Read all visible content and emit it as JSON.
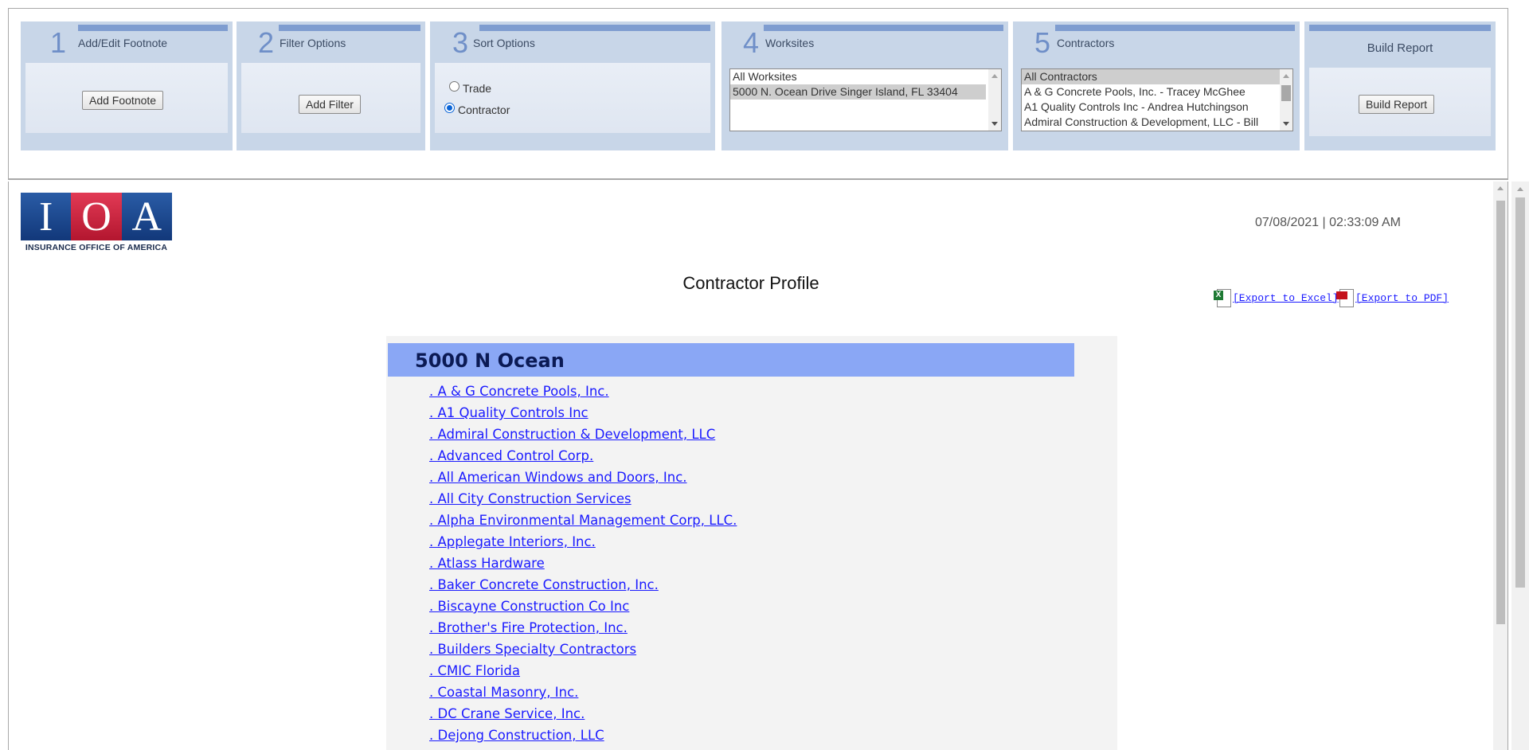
{
  "steps": [
    {
      "num": "1",
      "title": "Add/Edit Footnote",
      "button": "Add Footnote"
    },
    {
      "num": "2",
      "title": "Filter Options",
      "button": "Add Filter"
    },
    {
      "num": "3",
      "title": "Sort Options",
      "options": [
        "Trade",
        "Contractor"
      ],
      "selected": "Contractor"
    },
    {
      "num": "4",
      "title": "Worksites",
      "items": [
        "All Worksites",
        "5000 N. Ocean Drive Singer Island, FL 33404"
      ]
    },
    {
      "num": "5",
      "title": "Contractors",
      "items": [
        "All Contractors",
        "A & G Concrete Pools, Inc. - Tracey McGhee",
        "A1 Quality Controls Inc - Andrea Hutchingson",
        "Admiral Construction & Development, LLC - Bill"
      ]
    },
    {
      "title": "Build Report",
      "button": "Build Report"
    }
  ],
  "logo": {
    "letters": [
      "I",
      "O",
      "A"
    ],
    "tagline": "INSURANCE OFFICE OF AMERICA"
  },
  "report": {
    "timestamp": "07/08/2021 | 02:33:09 AM",
    "title": "Contractor Profile",
    "export_excel": "[Export to Excel]",
    "export_pdf": "[Export to PDF]",
    "site_name": "5000 N Ocean",
    "companies": [
      ". A & G Concrete Pools, Inc.",
      ". A1 Quality Controls Inc",
      ". Admiral Construction & Development, LLC",
      ". Advanced Control Corp.",
      ". All American Windows and Doors, Inc.",
      ". All City Construction Services",
      ". Alpha Environmental Management Corp, LLC.",
      ". Applegate Interiors, Inc.",
      ". Atlass Hardware",
      ". Baker Concrete Construction, Inc.",
      ". Biscayne Construction Co Inc",
      ". Brother's Fire Protection, Inc.",
      ". Builders Specialty Contractors",
      ". CMIC Florida",
      ". Coastal Masonry, Inc.",
      ". DC Crane Service, Inc.",
      ". Dejong Construction, LLC"
    ]
  },
  "colors": {
    "panel": "#c8d6e8",
    "accent_bar": "#7f9dd0",
    "site_header": "#8aa7f5",
    "link": "#1a1aff"
  }
}
